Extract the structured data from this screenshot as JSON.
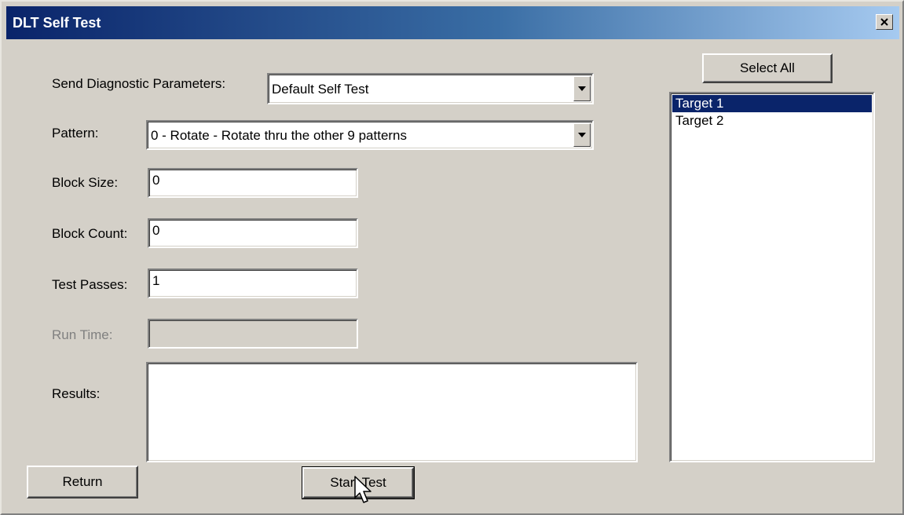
{
  "window": {
    "title": "DLT Self Test",
    "close_label": "×"
  },
  "form": {
    "diag_label": "Send Diagnostic Parameters:",
    "diag_value": "Default Self Test",
    "pattern_label": "Pattern:",
    "pattern_value": "0 - Rotate - Rotate thru the other 9 patterns",
    "block_size_label": "Block Size:",
    "block_size_value": "0",
    "block_count_label": "Block Count:",
    "block_count_value": "0",
    "test_passes_label": "Test Passes:",
    "test_passes_value": "1",
    "run_time_label": "Run Time:",
    "run_time_value": "",
    "results_label": "Results:",
    "results_value": ""
  },
  "buttons": {
    "select_all": "Select All",
    "return": "Return",
    "start_test": "Start Test"
  },
  "targets": {
    "items": [
      {
        "label": "Target 1",
        "selected": true
      },
      {
        "label": "Target 2",
        "selected": false
      }
    ]
  },
  "colors": {
    "title_gradient_start": "#0a246a",
    "title_gradient_end": "#a6caf0",
    "face": "#d4d0c8",
    "selection": "#0a246a"
  },
  "icons": {
    "close": "close-icon",
    "dropdown": "chevron-down-icon",
    "cursor": "mouse-pointer-icon"
  }
}
